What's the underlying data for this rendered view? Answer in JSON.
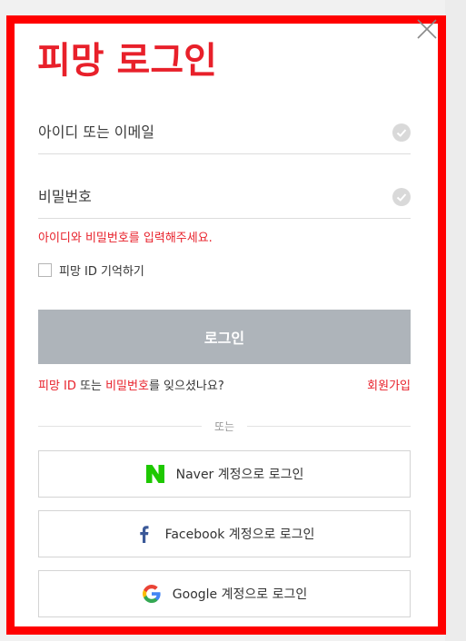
{
  "dialog": {
    "title": "피망 로그인",
    "close_icon": "close-icon"
  },
  "form": {
    "id_placeholder": "아이디 또는 이메일",
    "password_placeholder": "비밀번호",
    "error_message": "아이디와 비밀번호를 입력해주세요.",
    "remember_label": "피망 ID 기억하기",
    "remember_checked": false,
    "login_label": "로그인"
  },
  "links": {
    "forgot_part1": "피망 ID",
    "forgot_part2": " 또는 ",
    "forgot_part3": "비밀번호",
    "forgot_part4": "를 잊으셨나요?",
    "signup": "회원가입"
  },
  "divider": {
    "label": "또는"
  },
  "social": [
    {
      "label": "Naver 계정으로 로그인",
      "icon": "naver-icon",
      "color": "#1ec800"
    },
    {
      "label": "Facebook 계정으로 로그인",
      "icon": "facebook-icon",
      "color": "#3b5998"
    },
    {
      "label": "Google 계정으로 로그인",
      "icon": "google-icon",
      "color": "#4285f4"
    }
  ],
  "colors": {
    "accent": "#e8202a",
    "frame": "#ff0000",
    "login_button": "#aeb4ba"
  }
}
